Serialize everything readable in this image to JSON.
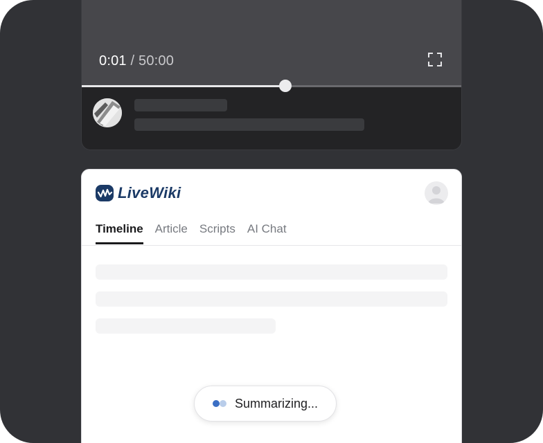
{
  "player": {
    "current_time": "0:01",
    "separator": " / ",
    "total_time": "50:00",
    "progress_fraction": 0.537,
    "fullscreen_icon": "fullscreen-icon"
  },
  "wiki": {
    "logo_text": "LiveWiki",
    "brand_color": "#1b3a66",
    "tabs": [
      {
        "label": "Timeline",
        "active": true
      },
      {
        "label": "Article",
        "active": false
      },
      {
        "label": "Scripts",
        "active": false
      },
      {
        "label": "AI Chat",
        "active": false
      }
    ],
    "status": {
      "label": "Summarizing...",
      "dot_colors": [
        "#3b6fc4",
        "#b9cdea"
      ]
    }
  }
}
